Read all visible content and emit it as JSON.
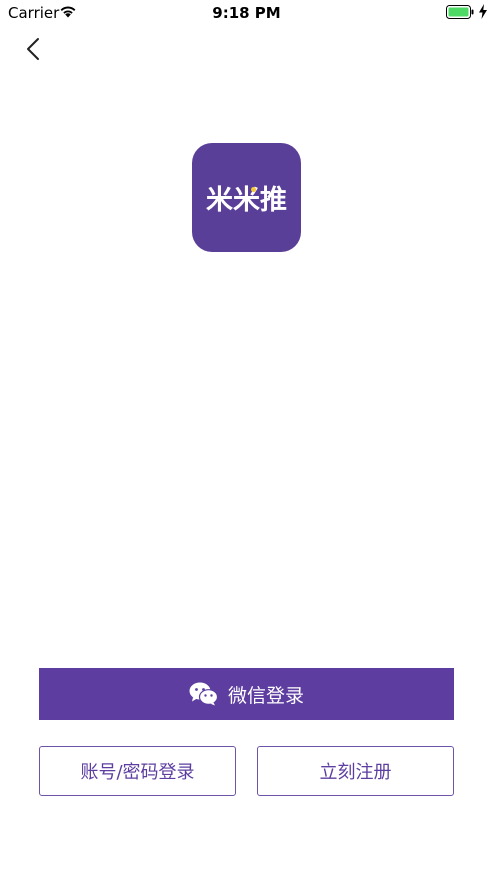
{
  "status_bar": {
    "carrier": "Carrier",
    "time": "9:18 PM",
    "wifi_icon": "wifi-icon",
    "battery_icon": "battery-icon",
    "battery_color": "#4cd964"
  },
  "nav": {
    "back_icon": "chevron-left-icon"
  },
  "app_logo": {
    "text": "米米推",
    "background": "#5a3f98",
    "accent_dot": "#f4c83a"
  },
  "login": {
    "wechat_label": "微信登录",
    "wechat_icon": "wechat-icon",
    "account_label": "账号/密码登录",
    "register_label": "立刻注册",
    "brand_color": "#5d3ea0"
  }
}
